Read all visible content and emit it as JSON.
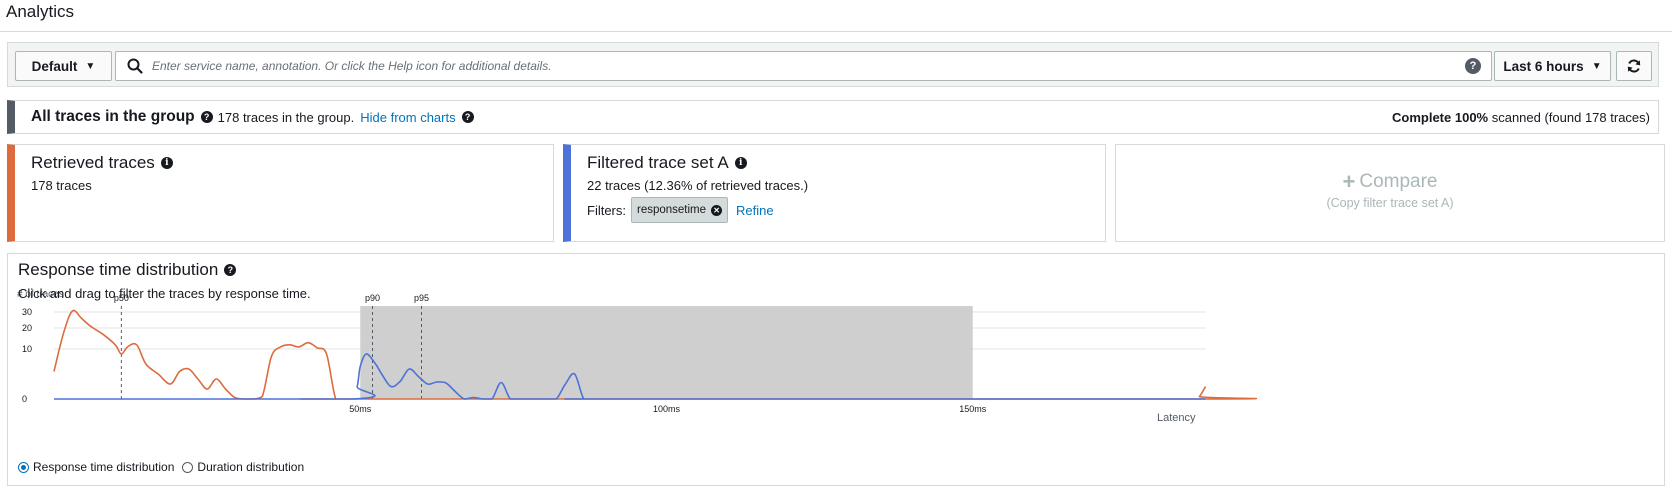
{
  "page": {
    "title": "Analytics"
  },
  "toolbar": {
    "group_label": "Default",
    "search_placeholder": "Enter service name, annotation. Or click the Help icon for additional details.",
    "time_range_label": "Last 6 hours"
  },
  "group": {
    "title": "All traces in the group",
    "count_text": "178 traces in the group.",
    "hide_link": "Hide from charts",
    "scan_status_bold": "Complete 100%",
    "scan_status_rest": " scanned (found 178 traces)"
  },
  "retrieved": {
    "title": "Retrieved traces",
    "count": "178 traces"
  },
  "filtered": {
    "title": "Filtered trace set A",
    "count": "22 traces (12.36% of retrieved traces.)",
    "filters_label": "Filters:",
    "chip_label": "responsetime",
    "refine_link": "Refine"
  },
  "compare": {
    "label": "Compare",
    "sub": "(Copy filter trace set A)"
  },
  "distribution": {
    "title": "Response time distribution",
    "description": "Click and drag to filter the traces by response time.",
    "radio_response": "Response time distribution",
    "radio_duration": "Duration distribution"
  },
  "colors": {
    "retrieved": "#dd6b3d",
    "filtered": "#4d72d8",
    "selection": "#cccccc"
  },
  "chart_data": {
    "type": "line",
    "ylabel": "# of traces",
    "xlabel": "Latency",
    "y_ticks": [
      0,
      10,
      20,
      30
    ],
    "x_ticks": [
      {
        "value": 50,
        "label": "50ms"
      },
      {
        "value": 100,
        "label": "100ms"
      },
      {
        "value": 150,
        "label": "150ms"
      }
    ],
    "x_range": [
      0,
      188
    ],
    "percentiles": [
      {
        "name": "p50",
        "value": 11
      },
      {
        "name": "p90",
        "value": 52
      },
      {
        "name": "p95",
        "value": 60
      }
    ],
    "selection_range": [
      50,
      150
    ],
    "series": [
      {
        "name": "Retrieved traces",
        "color": "#dd6b3d",
        "x": [
          0,
          1.5,
          3,
          4.5,
          6,
          8,
          10,
          11,
          12,
          13.5,
          15,
          17,
          19,
          20.5,
          22,
          23.5,
          25,
          26.5,
          28,
          29.5,
          31,
          32.5,
          34,
          35.5,
          37,
          38.5,
          40,
          41.5,
          43,
          44.5,
          46,
          47.5,
          49,
          49.8,
          50.5,
          188,
          187,
          186
        ],
        "y": [
          5.5,
          17,
          31,
          26,
          21,
          17,
          12,
          9,
          11,
          12,
          7,
          5,
          3,
          5.5,
          6,
          4,
          2,
          4,
          2,
          0.3,
          0,
          0,
          0.5,
          8.5,
          11,
          12,
          11,
          13,
          10.5,
          9,
          0,
          0,
          0,
          0,
          0,
          2.5,
          0.5,
          0
        ]
      },
      {
        "name": "Filtered trace set A",
        "color": "#4d72d8",
        "x": [
          0,
          48.5,
          49.5,
          50,
          51,
          52.5,
          53.5,
          55,
          56.5,
          58,
          59.5,
          61,
          62.5,
          64,
          65.5,
          67,
          68.5,
          70,
          71.5,
          73,
          74.5,
          76,
          77.5,
          79,
          80.5,
          82,
          83.5,
          85,
          86.5,
          88,
          89.5,
          91,
          188
        ],
        "y": [
          0,
          0,
          2.5,
          6.5,
          9,
          7,
          5,
          2.5,
          3.5,
          6,
          4.5,
          3,
          3.4,
          3.2,
          1.5,
          0,
          0.3,
          0,
          0,
          3.3,
          0,
          0,
          0,
          0,
          0,
          0,
          3,
          5,
          0,
          0,
          0,
          0,
          0
        ]
      }
    ]
  }
}
